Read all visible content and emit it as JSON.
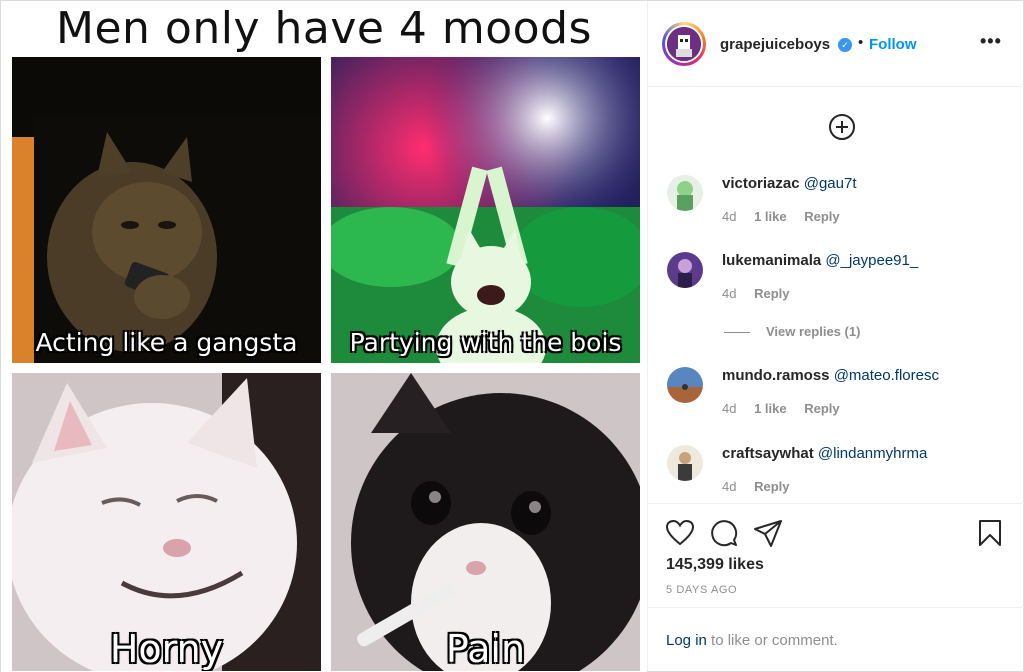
{
  "meme": {
    "title": "Men only have 4 moods",
    "panels": [
      {
        "caption": "Acting like a gangsta"
      },
      {
        "caption": "Partying with the bois"
      },
      {
        "caption": "Horny"
      },
      {
        "caption": "Pain"
      }
    ]
  },
  "header": {
    "username": "grapejuiceboys",
    "verified_glyph": "✓",
    "separator": "•",
    "follow_label": "Follow",
    "more_label": "•••"
  },
  "comments": [
    {
      "user": "victoriazac",
      "mention": "@gau7t",
      "age": "4d",
      "likes": "1 like",
      "reply": "Reply"
    },
    {
      "user": "lukemanimala",
      "mention": "@_jaypee91_",
      "age": "4d",
      "reply": "Reply"
    },
    {
      "user": "mundo.ramoss",
      "mention": "@mateo.floresc",
      "age": "4d",
      "likes": "1 like",
      "reply": "Reply"
    },
    {
      "user": "craftsaywhat",
      "mention": "@lindanmyhrma",
      "age": "4d",
      "reply": "Reply"
    }
  ],
  "view_replies": "View replies (1)",
  "stats": {
    "likes": "145,399 likes",
    "posted": "5 DAYS AGO"
  },
  "login": {
    "link": "Log in",
    "text": " to like or comment."
  },
  "icons": [
    "heart-icon",
    "comment-icon",
    "share-icon",
    "bookmark-icon",
    "add-circle-icon",
    "more-icon",
    "verified-icon"
  ],
  "colors": {
    "accent": "#0095f6",
    "mention": "#00376b",
    "muted": "#8e8e8e"
  }
}
